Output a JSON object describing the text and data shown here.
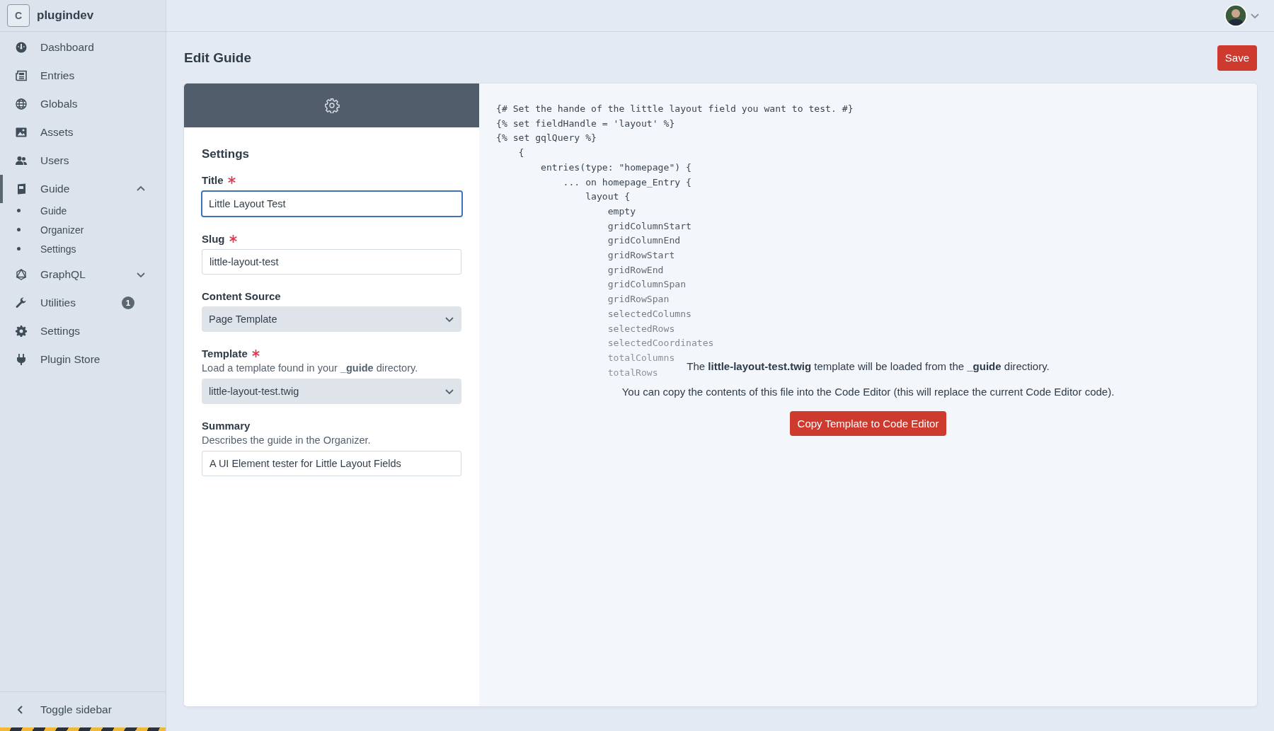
{
  "site": {
    "logo_letter": "C",
    "name": "plugindev"
  },
  "nav": [
    {
      "label": "Dashboard",
      "selected": false
    },
    {
      "label": "Entries",
      "selected": false
    },
    {
      "label": "Globals",
      "selected": false
    },
    {
      "label": "Assets",
      "selected": false
    },
    {
      "label": "Users",
      "selected": false
    },
    {
      "label": "Guide",
      "selected": true,
      "expanded": true,
      "children": [
        {
          "label": "Guide"
        },
        {
          "label": "Organizer"
        },
        {
          "label": "Settings"
        }
      ]
    },
    {
      "label": "GraphQL",
      "selected": false,
      "expanded": false
    },
    {
      "label": "Utilities",
      "selected": false,
      "badge": "1"
    },
    {
      "label": "Settings",
      "selected": false
    },
    {
      "label": "Plugin Store",
      "selected": false
    }
  ],
  "toggle_sidebar": "Toggle sidebar",
  "page": {
    "title": "Edit Guide",
    "save_button": "Save"
  },
  "settings": {
    "heading": "Settings",
    "fields": [
      {
        "kind": "text",
        "label": "Title",
        "required": true,
        "focused": true,
        "value": "Little Layout Test"
      },
      {
        "kind": "text",
        "label": "Slug",
        "required": true,
        "focused": false,
        "value": "little-layout-test"
      },
      {
        "kind": "select",
        "label": "Content Source",
        "required": false,
        "focused": false,
        "value": "Page Template"
      },
      {
        "kind": "select",
        "label": "Template",
        "required": true,
        "focused": false,
        "hint": "Load a template found in your **_guide** directory.",
        "value": "little-layout-test.twig"
      },
      {
        "kind": "text",
        "label": "Summary",
        "required": false,
        "focused": false,
        "hint": "Describes the guide in the Organizer.",
        "value": "A UI Element tester for Little Layout Fields"
      }
    ]
  },
  "code": {
    "lines": [
      "{# Set the hande of the little layout field you want to test. #}",
      "{% set fieldHandle = 'layout' %}",
      "{% set gqlQuery %}",
      "    {",
      "        entries(type: \"homepage\") {",
      "            ... on homepage_Entry {",
      "                layout {",
      "                    empty",
      "                    gridColumnStart",
      "                    gridColumnEnd",
      "                    gridRowStart",
      "                    gridRowEnd",
      "                    gridColumnSpan",
      "                    gridRowSpan",
      "                    selectedColumns",
      "                    selectedRows",
      "                    selectedCoordinates",
      "                    totalColumns",
      "                    totalRows"
    ]
  },
  "notice": {
    "message": "The **little-layout-test.twig** template will be loaded from the **_guide** directiory.",
    "note": "You can copy the contents of this file into the Code Editor (this will replace the current Code Editor code).",
    "button": "Copy Template to Code Editor"
  }
}
